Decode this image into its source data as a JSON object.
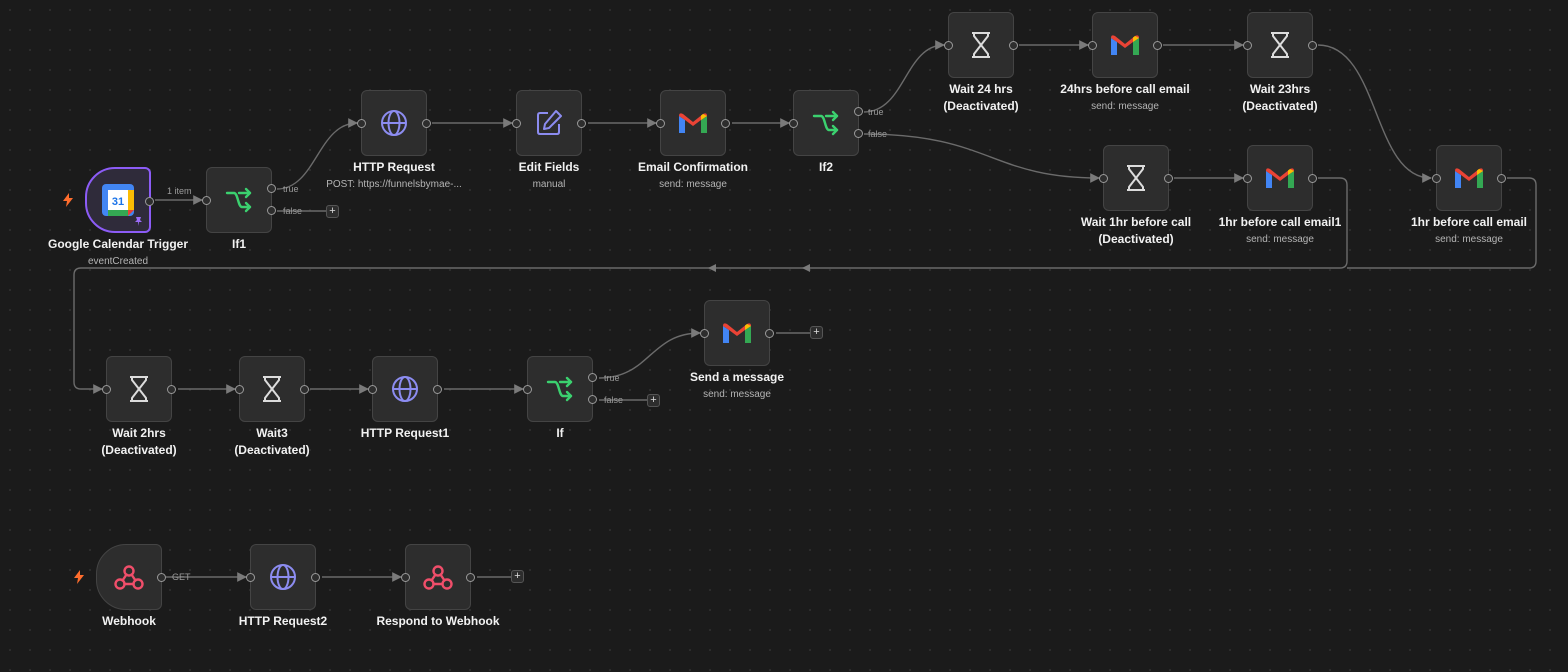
{
  "colors": {
    "canvas_bg": "#1b1b1b",
    "node_bg": "#2d2d2d",
    "edge": "#6b6b6b",
    "if_icon": "#3bd16f",
    "http_icon": "#8c8cf0",
    "webhook_icon": "#f04e6a",
    "trigger_bolt": "#ff6d2d",
    "selected_border": "#8c5cf6"
  },
  "nodes": {
    "gcal": {
      "name": "Google Calendar Trigger",
      "sub": "eventCreated",
      "icon": "google-calendar-icon",
      "icon_text": "31"
    },
    "if1": {
      "name": "If1",
      "icon": "if-branch-icon"
    },
    "http": {
      "name": "HTTP Request",
      "sub": "POST: https://funnelsbymae-...",
      "icon": "globe-icon"
    },
    "edit": {
      "name": "Edit Fields",
      "sub": "manual",
      "icon": "edit-pen-icon"
    },
    "emailconf": {
      "name": "Email Confirmation",
      "sub": "send: message",
      "icon": "gmail-icon"
    },
    "if2": {
      "name": "If2",
      "icon": "if-branch-icon"
    },
    "wait24": {
      "name": "Wait 24 hrs",
      "name2": "(Deactivated)",
      "icon": "hourglass-icon"
    },
    "email24": {
      "name": "24hrs before call email",
      "sub": "send: message",
      "icon": "gmail-icon"
    },
    "wait23": {
      "name": "Wait 23hrs",
      "name2": "(Deactivated)",
      "icon": "hourglass-icon"
    },
    "wait1": {
      "name": "Wait 1hr before call",
      "name2": "(Deactivated)",
      "icon": "hourglass-icon"
    },
    "email1hr1": {
      "name": "1hr before call email1",
      "sub": "send: message",
      "icon": "gmail-icon"
    },
    "email1hr": {
      "name": "1hr before call email",
      "sub": "send: message",
      "icon": "gmail-icon"
    },
    "wait2": {
      "name": "Wait 2hrs",
      "name2": "(Deactivated)",
      "icon": "hourglass-icon"
    },
    "wait3": {
      "name": "Wait3",
      "name2": "(Deactivated)",
      "icon": "hourglass-icon"
    },
    "http1": {
      "name": "HTTP Request1",
      "icon": "globe-icon"
    },
    "if": {
      "name": "If",
      "icon": "if-branch-icon"
    },
    "send": {
      "name": "Send a message",
      "sub": "send: message",
      "icon": "gmail-icon"
    },
    "webhook": {
      "name": "Webhook",
      "icon": "webhook-icon"
    },
    "http2": {
      "name": "HTTP Request2",
      "icon": "globe-icon"
    },
    "respond": {
      "name": "Respond to Webhook",
      "icon": "webhook-icon"
    }
  },
  "edge_labels": {
    "items": "1 item",
    "true": "true",
    "false": "false",
    "get": "GET",
    "add": "+"
  }
}
